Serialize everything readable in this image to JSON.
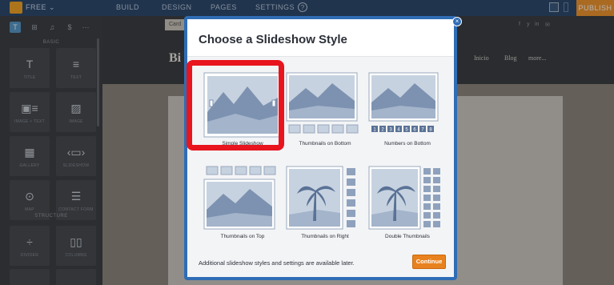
{
  "topbar": {
    "plan_label": "FREE ⌄",
    "nav": [
      "BUILD",
      "DESIGN",
      "PAGES",
      "SETTINGS"
    ],
    "help_label": "?",
    "publish_label": "PUBLISH"
  },
  "sidebar": {
    "tabs": [
      "T",
      "⊞",
      "♫",
      "$",
      "⋯"
    ],
    "sections": {
      "basic": "BASIC",
      "structure": "STRUCTURE"
    },
    "tools": [
      {
        "label": "TITLE",
        "icon": "T",
        "icon_name": "title-icon"
      },
      {
        "label": "TEXT",
        "icon": "≡",
        "icon_name": "text-icon"
      },
      {
        "label": "IMAGE + TEXT",
        "icon": "▣≡",
        "icon_name": "image-text-icon"
      },
      {
        "label": "IMAGE",
        "icon": "▨",
        "icon_name": "image-icon"
      },
      {
        "label": "GALLERY",
        "icon": "▦",
        "icon_name": "gallery-icon"
      },
      {
        "label": "SLIDESHOW",
        "icon": "‹▭›",
        "icon_name": "slideshow-icon"
      },
      {
        "label": "MAP",
        "icon": "⊙",
        "icon_name": "map-icon"
      },
      {
        "label": "CONTACT FORM",
        "icon": "☰",
        "icon_name": "contact-form-icon"
      },
      {
        "label": "DIVIDER",
        "icon": "÷",
        "icon_name": "divider-icon"
      },
      {
        "label": "COLUMNS",
        "icon": "▯▯",
        "icon_name": "columns-icon"
      }
    ]
  },
  "canvas": {
    "url_text": "Card",
    "brand": "Bi",
    "nav": [
      "Inicio",
      "Blog",
      "more..."
    ],
    "social": [
      "f",
      "y",
      "in",
      "✉"
    ]
  },
  "modal": {
    "title": "Choose a Slideshow Style",
    "options": [
      {
        "caption": "Simple Slideshow",
        "selected": true
      },
      {
        "caption": "Thumbnails on Bottom",
        "selected": false
      },
      {
        "caption": "Numbers on Bottom",
        "selected": false
      },
      {
        "caption": "Thumbnails on Top",
        "selected": false
      },
      {
        "caption": "Thumbnails on Right",
        "selected": false
      },
      {
        "caption": "Double Thumbnails",
        "selected": false
      }
    ],
    "numbers": [
      "1",
      "2",
      "3",
      "4",
      "5",
      "6",
      "7",
      "8"
    ],
    "footer_text": "Additional slideshow styles and settings are available later.",
    "continue_label": "Continue",
    "close_icon": "×"
  },
  "colors": {
    "accent": "#2f6db5",
    "highlight": "#e8141e",
    "continue": "#e8821e",
    "publish": "#f08c1c"
  }
}
